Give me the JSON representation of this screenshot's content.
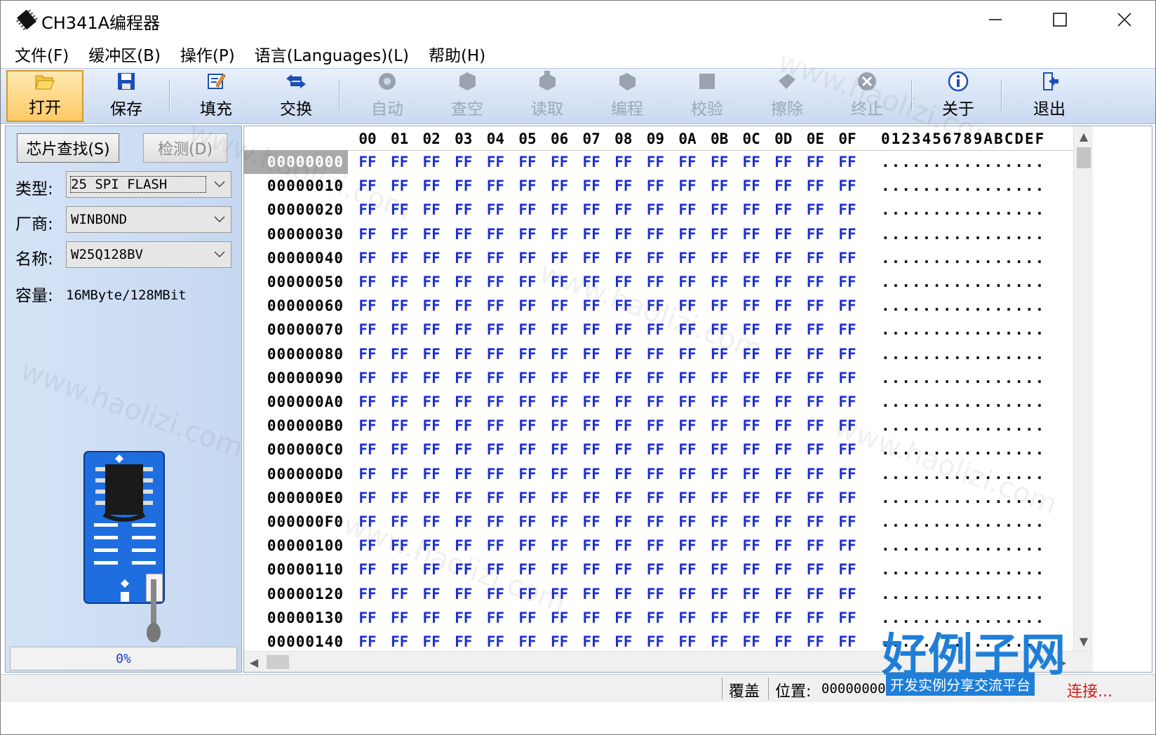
{
  "window": {
    "title": "CH341A编程器"
  },
  "menu": [
    "文件(F)",
    "缓冲区(B)",
    "操作(P)",
    "语言(Languages)(L)",
    "帮助(H)"
  ],
  "toolbar": {
    "open": "打开",
    "save": "保存",
    "fill": "填充",
    "swap": "交换",
    "auto": "自动",
    "blank_check": "查空",
    "read": "读取",
    "program": "编程",
    "verify": "校验",
    "erase": "擦除",
    "stop": "终止",
    "about": "关于",
    "exit": "退出"
  },
  "left": {
    "find_chip_button": "芯片查找(S)",
    "detect_button": "检测(D)",
    "type_label": "类型:",
    "type_value": "25 SPI FLASH",
    "vendor_label": "厂商:",
    "vendor_value": "WINBOND",
    "name_label": "名称:",
    "name_value": "W25Q128BV",
    "capacity_label": "容量:",
    "capacity_value": "16MByte/128MBit",
    "progress": "0%"
  },
  "hex": {
    "header_columns": [
      "00",
      "01",
      "02",
      "03",
      "04",
      "05",
      "06",
      "07",
      "08",
      "09",
      "0A",
      "0B",
      "0C",
      "0D",
      "0E",
      "0F"
    ],
    "ascii_header": "0123456789ABCDEF",
    "rows": [
      {
        "addr": "00000000"
      },
      {
        "addr": "00000010"
      },
      {
        "addr": "00000020"
      },
      {
        "addr": "00000030"
      },
      {
        "addr": "00000040"
      },
      {
        "addr": "00000050"
      },
      {
        "addr": "00000060"
      },
      {
        "addr": "00000070"
      },
      {
        "addr": "00000080"
      },
      {
        "addr": "00000090"
      },
      {
        "addr": "000000A0"
      },
      {
        "addr": "000000B0"
      },
      {
        "addr": "000000C0"
      },
      {
        "addr": "000000D0"
      },
      {
        "addr": "000000E0"
      },
      {
        "addr": "000000F0"
      },
      {
        "addr": "00000100"
      },
      {
        "addr": "00000110"
      },
      {
        "addr": "00000120"
      },
      {
        "addr": "00000130"
      },
      {
        "addr": "00000140"
      }
    ],
    "byte_value": "FF",
    "ascii_value": "................",
    "byte_color": "#1d2fd0"
  },
  "status": {
    "mode": "覆盖",
    "position_label": "位置:",
    "position_value": "00000000",
    "connection": "连接..."
  },
  "watermark": {
    "logo_big": "好例子网",
    "logo_small": "开发实例分享交流平台",
    "repeat_text": "www.haolizi.com"
  }
}
